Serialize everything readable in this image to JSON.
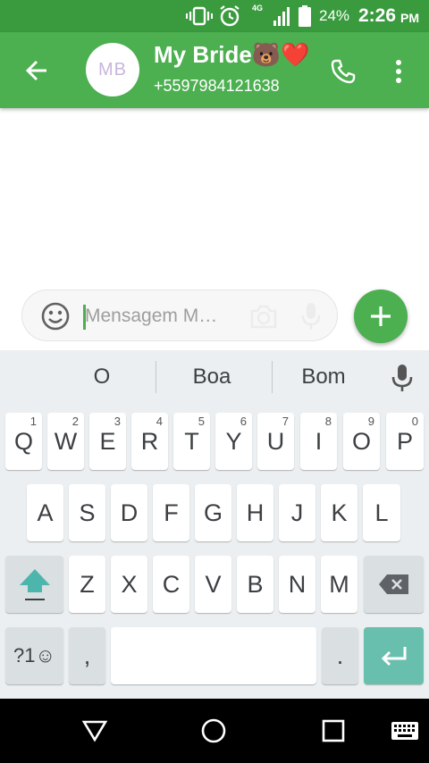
{
  "status_bar": {
    "network_label": "4G",
    "battery": "24%",
    "time": "2:26",
    "ampm": "PM"
  },
  "header": {
    "avatar_initials": "MB",
    "contact_name": "My Bride🐻❤️",
    "contact_number": "+5597984121638"
  },
  "compose": {
    "placeholder": "Mensagem M…",
    "value": ""
  },
  "suggestions": [
    "O",
    "Boa",
    "Bom"
  ],
  "keyboard": {
    "row1": [
      {
        "label": "Q",
        "hint": "1"
      },
      {
        "label": "W",
        "hint": "2"
      },
      {
        "label": "E",
        "hint": "3"
      },
      {
        "label": "R",
        "hint": "4"
      },
      {
        "label": "T",
        "hint": "5"
      },
      {
        "label": "Y",
        "hint": "6"
      },
      {
        "label": "U",
        "hint": "7"
      },
      {
        "label": "I",
        "hint": "8"
      },
      {
        "label": "O",
        "hint": "9"
      },
      {
        "label": "P",
        "hint": "0"
      }
    ],
    "row2": [
      "A",
      "S",
      "D",
      "F",
      "G",
      "H",
      "J",
      "K",
      "L"
    ],
    "row3": [
      "Z",
      "X",
      "C",
      "V",
      "B",
      "N",
      "M"
    ],
    "symbols_label": "?1☺",
    "comma_label": ",",
    "period_label": "."
  },
  "colors": {
    "status_bar": "#3a9b3e",
    "app_bar": "#4caf50",
    "fab": "#4caf50",
    "enter_key": "#68bfae",
    "shift_icon": "#4db6ac"
  },
  "icons": {
    "back": "arrow-left-icon",
    "call": "phone-icon",
    "menu": "more-vert-icon",
    "emoji": "smiley-icon",
    "camera": "camera-icon",
    "mic": "mic-icon",
    "add": "plus-icon",
    "shift": "shift-arrow-icon",
    "backspace": "backspace-icon",
    "enter": "enter-icon",
    "nav_back": "triangle-back-icon",
    "nav_home": "circle-home-icon",
    "nav_recents": "square-recents-icon",
    "nav_keyboard": "keyboard-icon"
  }
}
